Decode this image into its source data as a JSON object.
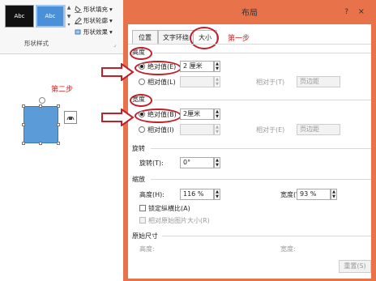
{
  "ribbon": {
    "style_samples": [
      "Abc",
      "Abc"
    ],
    "shape_fill": "形状填充",
    "shape_outline": "形状轮廓",
    "shape_effects": "形状效果",
    "group_label": "形状样式"
  },
  "canvas": {
    "step2": "第二步"
  },
  "dialog": {
    "title": "布局",
    "help": "?",
    "close": "×",
    "tabs": [
      "位置",
      "文字环绕",
      "大小"
    ],
    "step1": "第一步",
    "height": {
      "section": "高度",
      "absolute_label": "绝对值(E)",
      "absolute_value": "2 厘米",
      "relative_label": "相对值(L)",
      "relative_to_label": "相对于(T)",
      "relative_to_value": "页边距"
    },
    "width": {
      "section": "宽度",
      "absolute_label": "绝对值(B)",
      "absolute_value": "2厘米",
      "relative_label": "相对值(I)",
      "relative_to_label": "相对于(E)",
      "relative_to_value": "页边距"
    },
    "rotate": {
      "section": "旋转",
      "label": "旋转(T):",
      "value": "0°"
    },
    "scale": {
      "section": "缩放",
      "height_label": "高度(H):",
      "height_value": "116 %",
      "width_label": "宽度(W):",
      "width_value": "93 %",
      "lock_aspect": "锁定纵横比(A)",
      "relative_original": "相对原始图片大小(R)"
    },
    "original": {
      "section": "原始尺寸",
      "height_label": "高度:",
      "width_label": "宽度:"
    },
    "reset": "重置(S)"
  },
  "colors": {
    "dialog_frame": "#e8734a",
    "annotation_red": "#c0202a",
    "shape_fill": "#5a9bd8"
  }
}
